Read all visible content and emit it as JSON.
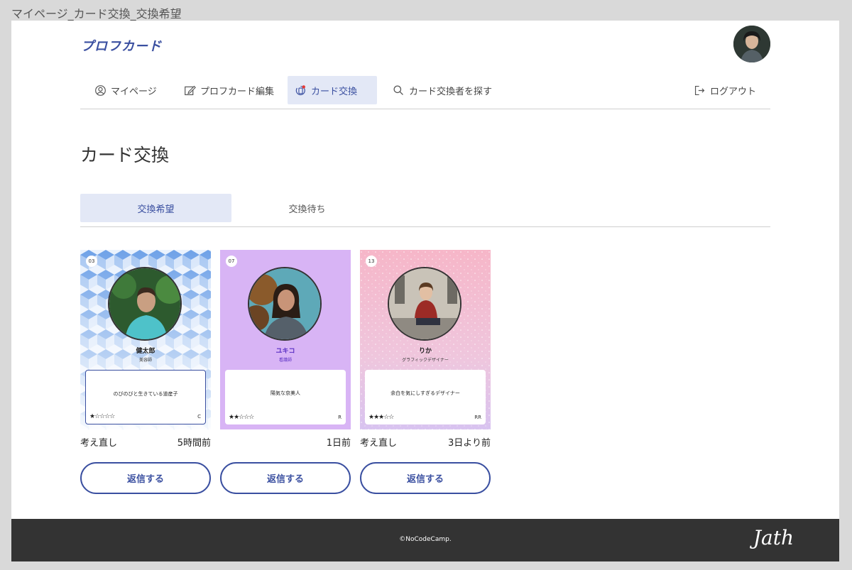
{
  "frame_title": "マイページ_カード交換_交換希望",
  "brand": {
    "logo_text": "プロフカード"
  },
  "nav": {
    "items": [
      {
        "label": "マイページ",
        "icon": "user-circle-icon"
      },
      {
        "label": "プロフカード編集",
        "icon": "edit-icon"
      },
      {
        "label": "カード交換",
        "icon": "card-exchange-icon",
        "active": true,
        "badge_color": "#e53935"
      },
      {
        "label": "カード交換者を探す",
        "icon": "search-icon"
      }
    ],
    "logout": {
      "label": "ログアウト",
      "icon": "logout-icon"
    }
  },
  "main": {
    "title": "カード交換",
    "tabs": [
      {
        "label": "交換希望",
        "active": true
      },
      {
        "label": "交換待ち",
        "active": false
      }
    ],
    "cards": [
      {
        "number": "03",
        "name": "健太郎",
        "role": "美容師",
        "quote": "のびのびと生きている道産子",
        "stars": "★☆☆☆☆",
        "rank": "C",
        "status": "考え直し",
        "time": "5時間前",
        "reply_label": "返信する",
        "bg": "blue-cubes"
      },
      {
        "number": "07",
        "name": "ユキコ",
        "role": "看護師",
        "quote": "陽気な京美人",
        "stars": "★★☆☆☆",
        "rank": "R",
        "status": "",
        "time": "1日前",
        "reply_label": "返信する",
        "bg": "lavender"
      },
      {
        "number": "13",
        "name": "りか",
        "role": "グラフィックデザイナー",
        "quote": "余白を気にしすぎるデザイナー",
        "stars": "★★★☆☆",
        "rank": "RR",
        "status": "考え直し",
        "time": "3日より前",
        "reply_label": "返信する",
        "bg": "pink-glitter"
      }
    ]
  },
  "footer": {
    "copyright": "©NoCodeCamp.",
    "signature": "Jath"
  },
  "colors": {
    "accent": "#3a4fa0",
    "active_bg": "#e3e8f6",
    "footer_bg": "#333333"
  }
}
